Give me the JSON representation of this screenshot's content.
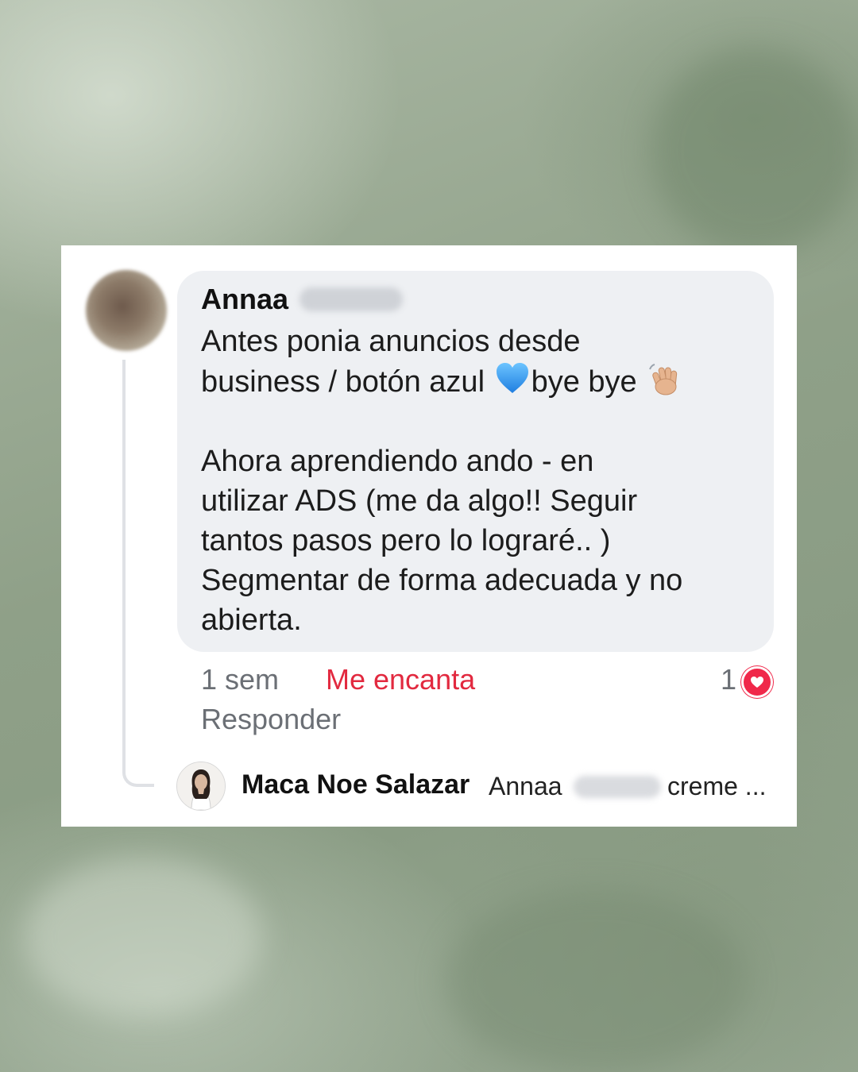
{
  "comment": {
    "author": "Annaa",
    "line1": "Antes ponia anuncios desde",
    "line2_before": "business / botón azul",
    "line2_after": "bye bye",
    "paragraph2": "Ahora aprendiendo ando - en\nutilizar ADS (me da algo!! Seguir\ntantos pasos pero lo lograré.. )\nSegmentar de forma adecuada y no\nabierta.",
    "emojis": [
      "blue-heart-icon",
      "waving-hand-icon"
    ]
  },
  "meta": {
    "time": "1 sem",
    "reaction_label": "Me encanta",
    "reaction_count": "1",
    "reply_label": "Responder"
  },
  "reply": {
    "author": "Maca Noe Salazar",
    "mention": "Annaa",
    "preview": "creme ..."
  },
  "colors": {
    "love": "#e2293f",
    "bubble": "#eef0f3",
    "heart_badge": "#f0284a"
  }
}
